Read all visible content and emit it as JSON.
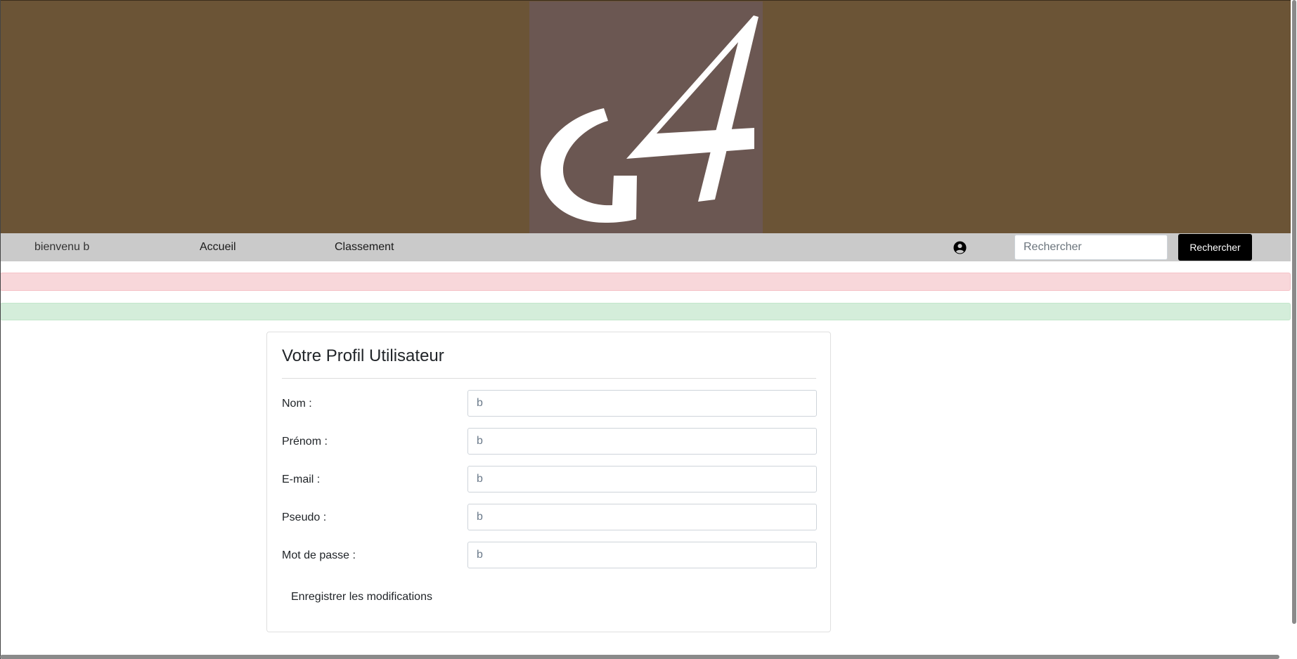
{
  "banner": {
    "logo_icon": "g4-logo-icon",
    "background_color": "#6b5436",
    "logo_background_color": "#6b5752"
  },
  "navbar": {
    "welcome_text": "bienvenu b",
    "links": [
      {
        "label": "Accueil"
      },
      {
        "label": "Classement"
      }
    ],
    "user_icon": "user-circle-icon",
    "search_placeholder": "Rechercher",
    "search_button_label": "Rechercher"
  },
  "alerts": {
    "danger_text": "",
    "success_text": ""
  },
  "profile": {
    "title": "Votre Profil Utilisateur",
    "fields": [
      {
        "label": "Nom :",
        "value": "b"
      },
      {
        "label": "Prénom :",
        "value": "b"
      },
      {
        "label": "E-mail :",
        "value": "b"
      },
      {
        "label": "Pseudo :",
        "value": "b"
      },
      {
        "label": "Mot de passe :",
        "value": "b"
      }
    ],
    "save_label": "Enregistrer les modifications"
  }
}
